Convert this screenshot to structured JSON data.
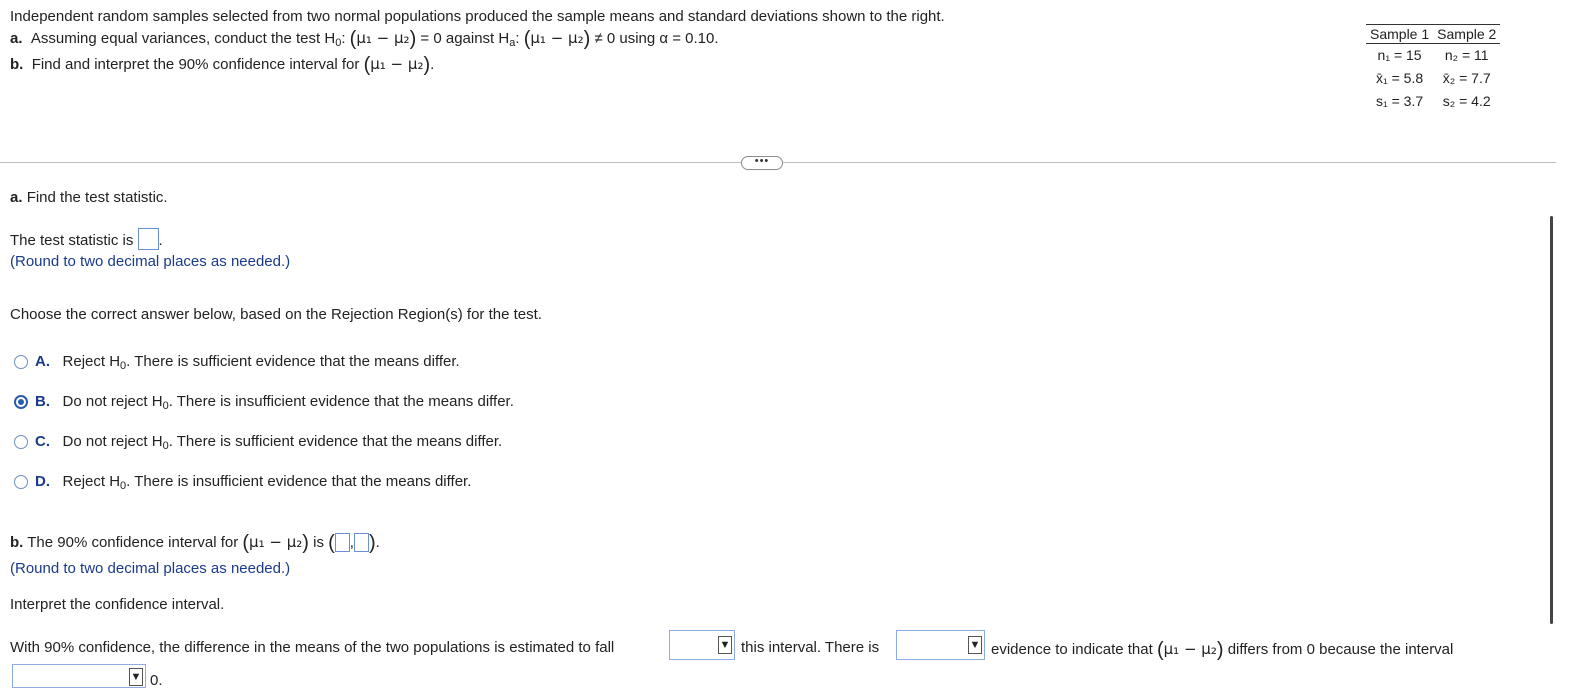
{
  "problem": {
    "intro": "Independent random samples selected from two normal populations produced the sample means and standard deviations shown to the right.",
    "part_a_letter": "a.",
    "part_a_text_start": "Assuming equal variances, conduct the test H",
    "part_a_against": "against H",
    "part_a_using": "using α = 0.10.",
    "part_b_letter": "b.",
    "part_b_text": "Find and interpret the 90% confidence interval for",
    "mu_diff": "μ₁ − μ₂",
    "null_value": "= 0",
    "alt_value": "≠ 0"
  },
  "samples_table": {
    "headers": [
      "Sample 1",
      "Sample 2"
    ],
    "rows": [
      [
        "n₁ = 15",
        "n₂ = 11"
      ],
      [
        "x̄₁ = 5.8",
        "x̄₂ = 7.7"
      ],
      [
        "s₁ = 3.7",
        "s₂ = 4.2"
      ]
    ]
  },
  "more_button": "•••",
  "section_a": {
    "heading_letter": "a.",
    "heading_text": "Find the test statistic.",
    "stat_label": "The test statistic is",
    "stat_hint": "(Round to two decimal places as needed.)",
    "choose_prompt": "Choose the correct answer below, based on the Rejection Region(s) for the test.",
    "selected_option": "B",
    "options": [
      {
        "letter": "A.",
        "pre": "Reject H",
        "post": ". There is sufficient evidence that the means differ."
      },
      {
        "letter": "B.",
        "pre": "Do not reject H",
        "post": ". There is insufficient evidence that the means differ."
      },
      {
        "letter": "C.",
        "pre": "Do not reject H",
        "post": ". There is sufficient evidence that the means differ."
      },
      {
        "letter": "D.",
        "pre": "Reject H",
        "post": ". There is insufficient evidence that the means differ."
      }
    ]
  },
  "section_b": {
    "heading_letter": "b.",
    "heading_text": "The 90% confidence interval for",
    "heading_is": "is",
    "hint": "(Round to two decimal places as needed.)",
    "interpret": "Interpret the confidence interval.",
    "sentence_part1": "With 90% confidence, the difference in the means of the two populations is estimated to fall",
    "sentence_part2": "this interval. There is",
    "sentence_part3": "evidence to indicate that",
    "sentence_part4": "differs from 0 because the interval",
    "sentence_end": "0."
  }
}
